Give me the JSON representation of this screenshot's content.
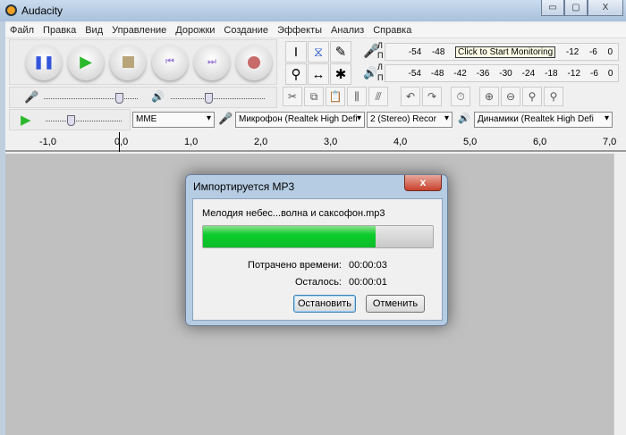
{
  "window": {
    "title": "Audacity",
    "min": "▭",
    "max": "▢",
    "close": "X"
  },
  "menu": [
    "Файл",
    "Правка",
    "Вид",
    "Управление",
    "Дорожки",
    "Создание",
    "Эффекты",
    "Анализ",
    "Справка"
  ],
  "meters": {
    "record_ticks": [
      "-54",
      "-48",
      "",
      "",
      "",
      "",
      "",
      "-12",
      "-6",
      "0"
    ],
    "tooltip": "Click to Start Monitoring",
    "play_ticks": [
      "-54",
      "-48",
      "-42",
      "-36",
      "-30",
      "-24",
      "-18",
      "-12",
      "-6",
      "0"
    ],
    "left": "Л",
    "right": "П"
  },
  "device": {
    "host": "MME",
    "mic": "Микрофон (Realtek High Defi",
    "channels": "2 (Stereo) Recor",
    "speaker": "Динамики (Realtek High Defi"
  },
  "ruler": [
    "-1,0",
    "0,0",
    "1,0",
    "2,0",
    "3,0",
    "4,0",
    "5,0",
    "6,0",
    "7,0"
  ],
  "dialog": {
    "title": "Импортируется MP3",
    "close": "x",
    "file": "Мелодия небес...волна и саксофон.mp3",
    "progress": 0.75,
    "elapsed_label": "Потрачено времени:",
    "elapsed": "00:00:03",
    "remaining_label": "Осталось:",
    "remaining": "00:00:01",
    "stop": "Остановить",
    "cancel": "Отменить"
  }
}
